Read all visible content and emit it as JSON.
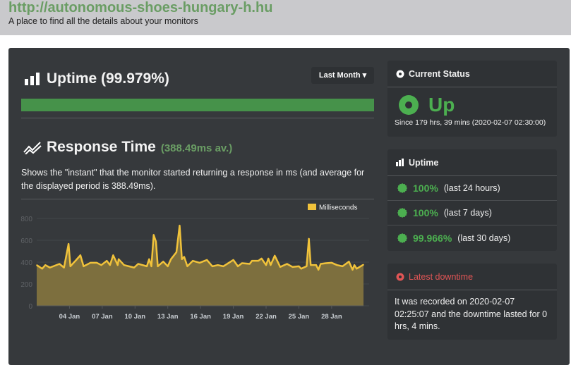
{
  "header": {
    "site": "http://autonomous-shoes-hungary-h.hu",
    "tagline": "A place to find all the details about your monitors"
  },
  "uptime": {
    "title": "Uptime (99.979%)",
    "percent": 99.979,
    "period_button": "Last Month ▾"
  },
  "response": {
    "title": "Response Time",
    "average": "(388.49ms av.)",
    "description": "Shows the \"instant\" that the monitor started returning a response in ms (and average for the displayed period is 388.49ms)."
  },
  "status": {
    "title": "Current Status",
    "state": "Up",
    "since": "Since 179 hrs, 39 mins (2020-02-07 02:30:00)"
  },
  "uptime_card": {
    "title": "Uptime",
    "rows": [
      {
        "value": "100%",
        "label": "(last 24 hours)"
      },
      {
        "value": "100%",
        "label": "(last 7 days)"
      },
      {
        "value": "99.966%",
        "label": "(last 30 days)"
      }
    ]
  },
  "downtime": {
    "title": "Latest downtime",
    "text": "It was recorded on 2020-02-07 02:25:07 and the downtime lasted for 0 hrs, 4 mins."
  },
  "colors": {
    "green": "#4caf50",
    "line": "#f0c23b",
    "fill": "#7d6f3e",
    "red": "#e05555"
  },
  "chart_data": {
    "type": "area",
    "legend": "Milliseconds",
    "legend_position": "top-right",
    "ylim": [
      0,
      800
    ],
    "yticks": [
      "0",
      "200",
      "400",
      "600",
      "800"
    ],
    "xticks": [
      "04 Jan",
      "07 Jan",
      "10 Jan",
      "13 Jan",
      "16 Jan",
      "19 Jan",
      "22 Jan",
      "25 Jan",
      "28 Jan"
    ],
    "xtick_dates": [
      "2020-01-04",
      "2020-01-07",
      "2020-01-10",
      "2020-01-13",
      "2020-01-16",
      "2020-01-19",
      "2020-01-22",
      "2020-01-25",
      "2020-01-28"
    ],
    "grid": true,
    "x": [
      "2020-01-01T00:00",
      "2020-01-01T12:00",
      "2020-01-01T19:00",
      "2020-01-02T05:00",
      "2020-01-03T02:00",
      "2020-01-03T12:00",
      "2020-01-03T22:00",
      "2020-01-04T02:00",
      "2020-01-04T14:00",
      "2020-01-05T00:00",
      "2020-01-05T07:00",
      "2020-01-05T22:00",
      "2020-01-06T12:00",
      "2020-01-06T22:00",
      "2020-01-07T10:00",
      "2020-01-07T17:00",
      "2020-01-08T00:00",
      "2020-01-08T10:00",
      "2020-01-08T12:00",
      "2020-01-09T00:00",
      "2020-01-09T22:00",
      "2020-01-10T07:00",
      "2020-01-11T02:00",
      "2020-01-11T07:00",
      "2020-01-11T12:00",
      "2020-01-11T17:00",
      "2020-01-11T22:00",
      "2020-01-12T02:00",
      "2020-01-12T14:00",
      "2020-01-13T00:00",
      "2020-01-13T07:00",
      "2020-01-13T19:00",
      "2020-01-14T02:00",
      "2020-01-14T07:00",
      "2020-01-14T12:00",
      "2020-01-14T19:00",
      "2020-01-15T07:00",
      "2020-01-15T22:00",
      "2020-01-16T14:00",
      "2020-01-17T02:00",
      "2020-01-17T14:00",
      "2020-01-18T02:00",
      "2020-01-19T00:00",
      "2020-01-19T10:00",
      "2020-01-19T19:00",
      "2020-01-20T12:00",
      "2020-01-20T17:00",
      "2020-01-21T07:00",
      "2020-01-21T14:00",
      "2020-01-22T00:00",
      "2020-01-22T05:00",
      "2020-01-22T10:00",
      "2020-01-22T19:00",
      "2020-01-23T07:00",
      "2020-01-23T22:00",
      "2020-01-24T10:00",
      "2020-01-25T00:00",
      "2020-01-25T05:00",
      "2020-01-25T17:00",
      "2020-01-25T22:00",
      "2020-01-26T02:00",
      "2020-01-26T14:00",
      "2020-01-26T19:00",
      "2020-01-27T00:00",
      "2020-01-27T12:00",
      "2020-01-28T00:00",
      "2020-01-28T12:00",
      "2020-01-29T00:00",
      "2020-01-29T14:00",
      "2020-01-29T22:00",
      "2020-01-30T02:00",
      "2020-01-30T07:00",
      "2020-01-30T22:00"
    ],
    "y": [
      373,
      340,
      373,
      350,
      384,
      350,
      567,
      362,
      416,
      463,
      362,
      394,
      394,
      373,
      412,
      373,
      463,
      373,
      427,
      373,
      350,
      384,
      362,
      427,
      362,
      649,
      588,
      362,
      405,
      362,
      427,
      491,
      735,
      427,
      448,
      362,
      412,
      394,
      420,
      362,
      373,
      362,
      420,
      362,
      390,
      384,
      412,
      412,
      433,
      373,
      433,
      373,
      459,
      356,
      384,
      356,
      362,
      340,
      362,
      614,
      373,
      373,
      330,
      384,
      390,
      394,
      373,
      362,
      405,
      330,
      373,
      340,
      377
    ]
  }
}
